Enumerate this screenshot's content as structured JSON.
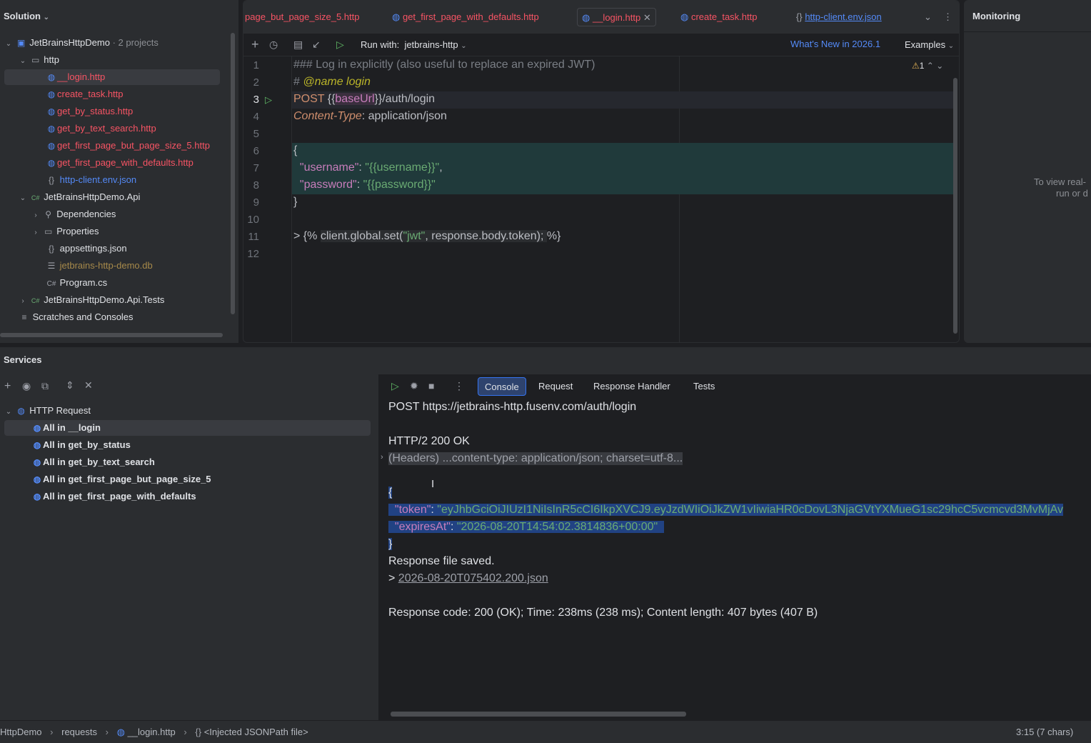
{
  "solution": {
    "title": "Solution",
    "root_label": "JetBrainsHttpDemo",
    "root_meta": "· 2 projects",
    "http_folder": "http",
    "http_files": [
      "__login.http",
      "create_task.http",
      "get_by_status.http",
      "get_by_text_search.http",
      "get_first_page_but_page_size_5.http",
      "get_first_page_with_defaults.http"
    ],
    "env_file": "http-client.env.json",
    "api_project": "JetBrainsHttpDemo.Api",
    "dependencies": "Dependencies",
    "properties": "Properties",
    "appsettings": "appsettings.json",
    "db_file": "jetbrains-http-demo.db",
    "program": "Program.cs",
    "tests_project": "JetBrainsHttpDemo.Api.Tests",
    "scratches": "Scratches and Consoles"
  },
  "editor": {
    "tabs": [
      "page_but_page_size_5.http",
      "get_first_page_with_defaults.http",
      "__login.http",
      "create_task.http",
      "http-client.env.json"
    ],
    "run_with_label": "Run with:",
    "run_with_value": "jetbrains-http",
    "whats_new": "What's New in 2026.1",
    "examples": "Examples",
    "warning_count": "1",
    "line_numbers": [
      "1",
      "2",
      "3",
      "4",
      "5",
      "6",
      "7",
      "8",
      "9",
      "10",
      "11",
      "12"
    ],
    "lines": {
      "l1": "### Log in explicitly (also useful to replace an expired JWT)",
      "l2_hash": "# ",
      "l2_tag": "@name",
      "l2_name": " login",
      "l3_method": "POST ",
      "l3_open": "{{",
      "l3_var": "baseUrl",
      "l3_rest": "}}/auth/login",
      "l4_key": "Content-Type",
      "l4_val": ": application/json",
      "l6": "{",
      "l7_key": "\"username\"",
      "l7_sep": ": ",
      "l7_val": "\"{{username}}\"",
      "l7_end": ",",
      "l8_key": "\"password\"",
      "l8_sep": ": ",
      "l8_val": "\"{{password}}\"",
      "l9": "}",
      "l11_a": "> {% ",
      "l11_b": "client.global.set(",
      "l11_c": "\"jwt\"",
      "l11_d": ", response.body.token); ",
      "l11_e": "%}"
    }
  },
  "monitoring": {
    "title": "Monitoring",
    "hint1": "To view real-",
    "hint2": "run or d"
  },
  "services": {
    "title": "Services",
    "root": "HTTP Request",
    "items": [
      "All in __login",
      "All in get_by_status",
      "All in get_by_text_search",
      "All in get_first_page_but_page_size_5",
      "All in get_first_page_with_defaults"
    ],
    "tabs": [
      "Console",
      "Request",
      "Response Handler",
      "Tests"
    ],
    "console": {
      "request_line": "POST https://jetbrains-http.fusenv.com/auth/login",
      "status_line": "HTTP/2 200 OK",
      "headers": "(Headers) ...content-type: application/json; charset=utf-8...",
      "open_brace": "{",
      "token_key": "\"token\"",
      "token_val": "\"eyJhbGciOiJIUzI1NiIsInR5cCI6IkpXVCJ9.eyJzdWIiOiJkZW1vIiwiaHR0cDovL3NjaGVtYXMueG1sc29hcC5vcmcvd3MvMjAv",
      "expires_key": "\"expiresAt\"",
      "expires_val": "\"2026-08-20T14:54:02.3814836+00:00\"",
      "close_brace": "}",
      "saved": "Response file saved.",
      "saved_prefix": "> ",
      "saved_file": "2026-08-20T075402.200.json",
      "summary": "Response code: 200 (OK); Time: 238ms (238 ms); Content length: 407 bytes (407 B)"
    }
  },
  "status": {
    "crumbs": [
      "HttpDemo",
      "requests",
      "__login.http",
      "<Injected JSONPath file>"
    ],
    "position": "3:15 (7 chars)"
  }
}
